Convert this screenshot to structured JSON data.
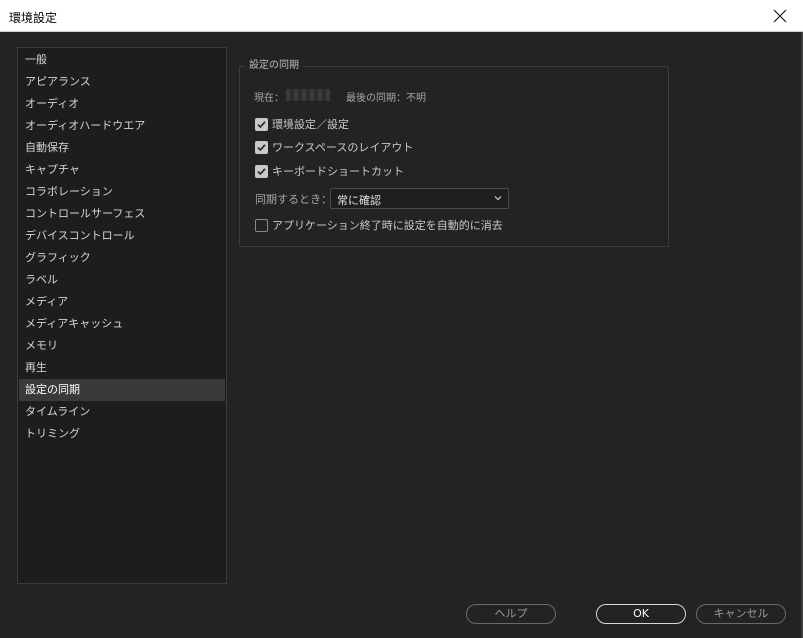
{
  "window": {
    "title": "環境設定",
    "close_icon": "close-icon"
  },
  "sidebar": {
    "items": [
      {
        "label": "一般",
        "selected": false
      },
      {
        "label": "アピアランス",
        "selected": false
      },
      {
        "label": "オーディオ",
        "selected": false
      },
      {
        "label": "オーディオハードウエア",
        "selected": false
      },
      {
        "label": "自動保存",
        "selected": false
      },
      {
        "label": "キャプチャ",
        "selected": false
      },
      {
        "label": "コラボレーション",
        "selected": false
      },
      {
        "label": "コントロールサーフェス",
        "selected": false
      },
      {
        "label": "デバイスコントロール",
        "selected": false
      },
      {
        "label": "グラフィック",
        "selected": false
      },
      {
        "label": "ラベル",
        "selected": false
      },
      {
        "label": "メディア",
        "selected": false
      },
      {
        "label": "メディアキャッシュ",
        "selected": false
      },
      {
        "label": "メモリ",
        "selected": false
      },
      {
        "label": "再生",
        "selected": false
      },
      {
        "label": "設定の同期",
        "selected": true
      },
      {
        "label": "タイムライン",
        "selected": false
      },
      {
        "label": "トリミング",
        "selected": false
      }
    ]
  },
  "sync": {
    "group_title": "設定の同期",
    "current_label": "現在：",
    "last_sync_label": "最後の同期：不明",
    "options": [
      {
        "label": "環境設定／設定",
        "checked": true
      },
      {
        "label": "ワークスペースのレイアウト",
        "checked": true
      },
      {
        "label": "キーボードショートカット",
        "checked": true
      }
    ],
    "sync_when_label": "同期するとき：",
    "sync_when_value": "常に確認",
    "clear_on_quit": {
      "label": "アプリケーション終了時に設定を自動的に消去",
      "checked": false
    }
  },
  "footer": {
    "help_label": "ヘルプ",
    "ok_label": "OK",
    "cancel_label": "キャンセル"
  },
  "colors": {
    "background": "#232323",
    "sidebar_bg": "#1d1d1d",
    "selected_item": "#3a3a3a"
  }
}
